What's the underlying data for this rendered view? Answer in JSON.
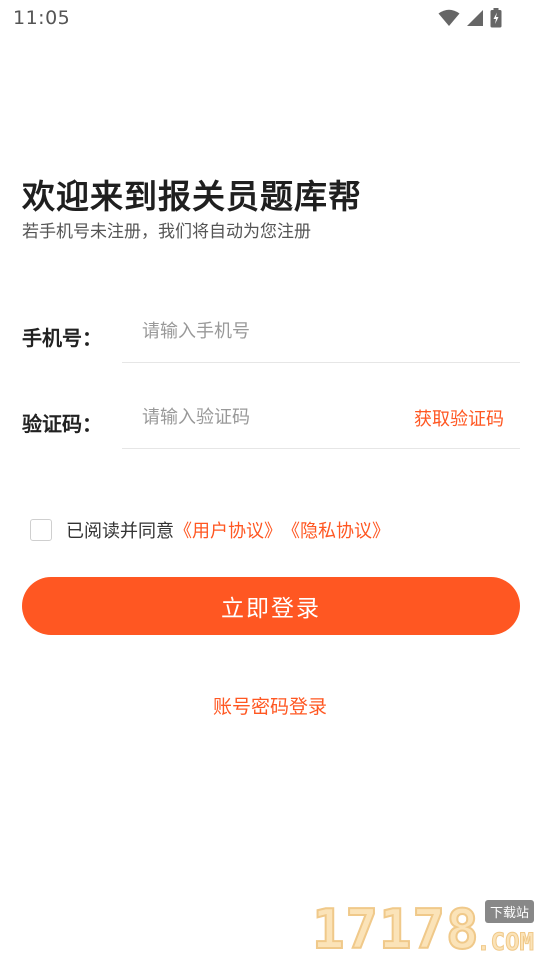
{
  "status_bar": {
    "time": "11:05",
    "icons": [
      "wifi-icon",
      "signal-icon",
      "battery-icon"
    ]
  },
  "header": {
    "title": "欢迎来到报关员题库帮",
    "subtitle": "若手机号未注册，我们将自动为您注册"
  },
  "form": {
    "phone": {
      "label": "手机号：",
      "placeholder": "请输入手机号",
      "value": ""
    },
    "code": {
      "label": "验证码：",
      "placeholder": "请输入验证码",
      "value": "",
      "get_code_label": "获取验证码"
    }
  },
  "agreement": {
    "checked": false,
    "text": "已阅读并同意",
    "user_agreement": "《用户协议》",
    "privacy_policy": "《隐私协议》"
  },
  "actions": {
    "login_label": "立即登录",
    "password_login_label": "账号密码登录"
  },
  "watermark": {
    "digits": "17178",
    "tag": "下载站",
    "suffix": ".COM"
  },
  "colors": {
    "accent": "#ff5722",
    "text_primary": "#1f1f1f",
    "text_secondary": "#555555",
    "placeholder": "#999999",
    "divider": "#e6e6e6"
  }
}
